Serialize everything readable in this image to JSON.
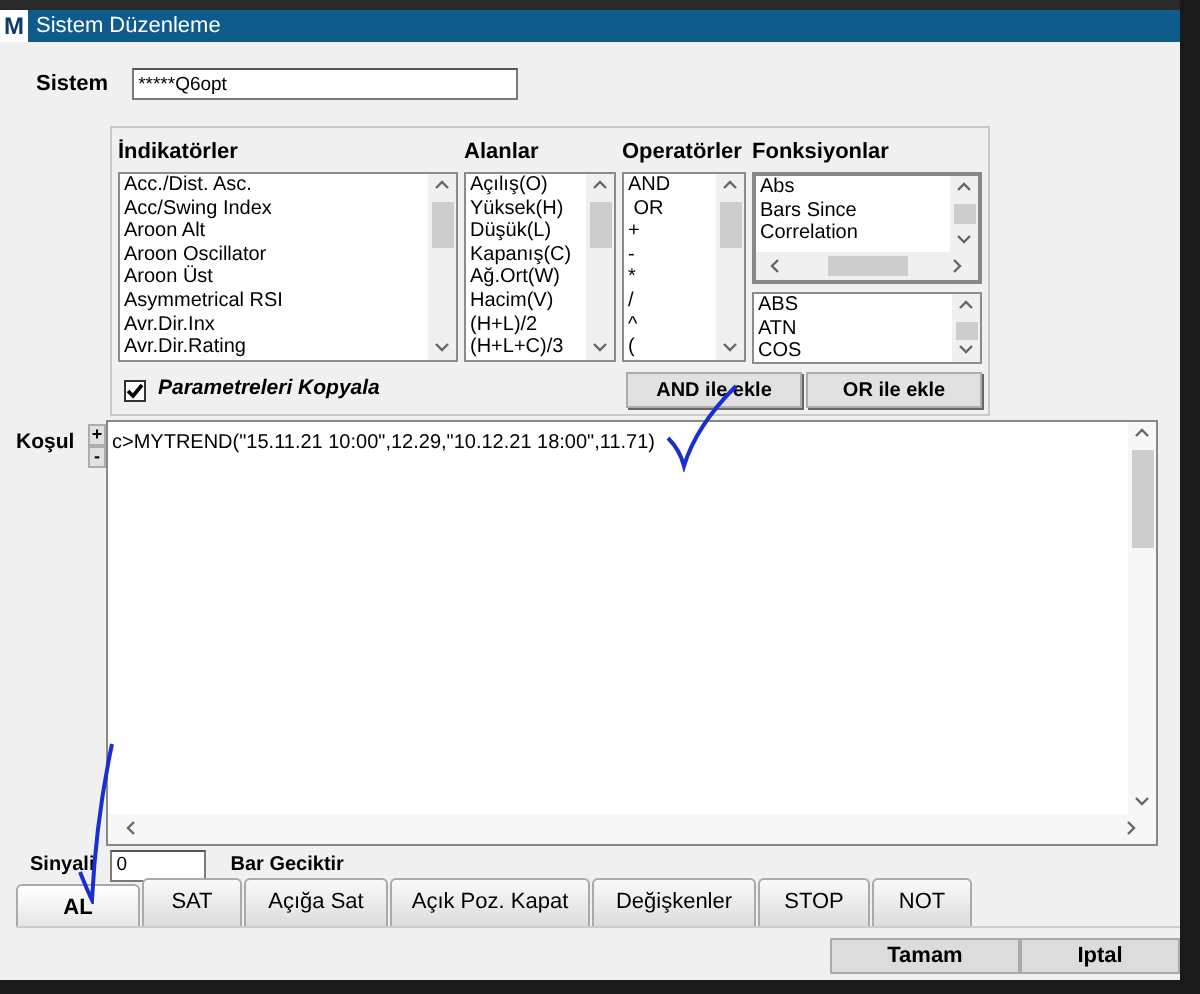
{
  "window": {
    "app_icon": "M",
    "title": "Sistem Düzenleme"
  },
  "system": {
    "label": "Sistem",
    "value": "*****Q6opt"
  },
  "lists": [
    {
      "title": "İndikatörler",
      "items": [
        "Acc./Dist. Asc.",
        "Acc/Swing Index",
        "Aroon Alt",
        "Aroon Oscillator",
        "Aroon Üst",
        "Asymmetrical RSI",
        "Avr.Dir.Inx",
        "Avr.Dir.Rating"
      ]
    },
    {
      "title": "Alanlar",
      "items": [
        "Açılış(O)",
        "Yüksek(H)",
        "Düşük(L)",
        "Kapanış(C)",
        "Ağ.Ort(W)",
        "Hacim(V)",
        "(H+L)/2",
        "(H+L+C)/3"
      ]
    },
    {
      "title": "Operatörler",
      "items": [
        "AND",
        " OR",
        "+",
        "-",
        "*",
        "/",
        "^",
        "("
      ]
    },
    {
      "title": "Fonksiyonlar",
      "items": [
        "Abs",
        "Bars Since",
        "Correlation"
      ],
      "sub_items": [
        "ABS",
        "ATN",
        "COS"
      ]
    }
  ],
  "copy_params": {
    "label": "Parametreleri Kopyala",
    "checked": true
  },
  "add_buttons": [
    "AND ile ekle",
    "OR ile ekle"
  ],
  "condition": {
    "label": "Koşul",
    "plus": "+",
    "minus": "-",
    "value": "c>MYTREND(\"15.11.21 10:00\",12.29,\"10.12.21 18:00\",11.71)"
  },
  "signal": {
    "label": "Sinyali",
    "value": "0",
    "suffix": "Bar Geciktir"
  },
  "tabs": [
    {
      "label": "AL",
      "selected": true
    },
    {
      "label": "SAT",
      "selected": false
    },
    {
      "label": "Açığa Sat",
      "selected": false
    },
    {
      "label": "Açık Poz. Kapat",
      "selected": false
    },
    {
      "label": "Değişkenler",
      "selected": false
    },
    {
      "label": "STOP",
      "selected": false
    },
    {
      "label": "NOT",
      "selected": false
    }
  ],
  "footer_buttons": [
    "Tamam",
    "Iptal"
  ]
}
